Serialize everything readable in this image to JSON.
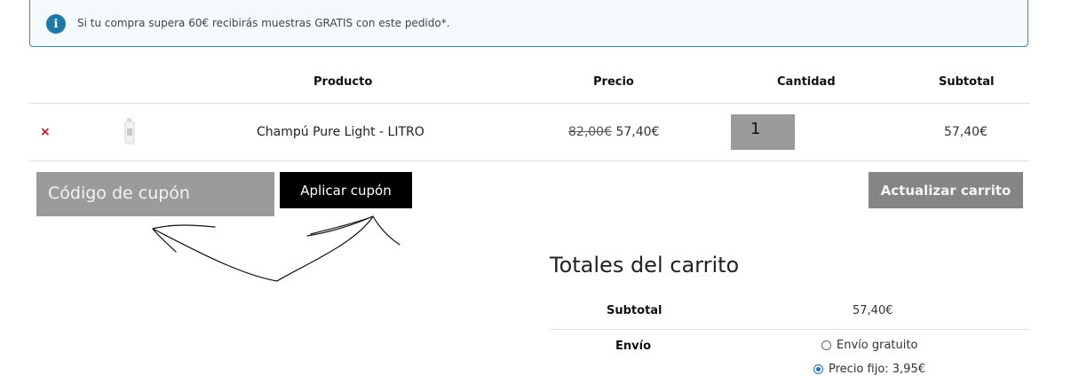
{
  "notice": {
    "icon": "info-icon",
    "text": "Si tu compra supera 60€ recibirás muestras GRATIS con este pedido*."
  },
  "table": {
    "headers": {
      "product": "Producto",
      "price": "Precio",
      "quantity": "Cantidad",
      "subtotal": "Subtotal"
    },
    "rows": [
      {
        "remove": "×",
        "name": "Champú Pure Light - LITRO",
        "old_price": "82,00€",
        "price": "57,40€",
        "quantity": "1",
        "subtotal": "57,40€"
      }
    ]
  },
  "coupon": {
    "placeholder": "Código de cupón",
    "apply_label": "Aplicar cupón"
  },
  "update_label": "Actualizar carrito",
  "totals": {
    "title": "Totales del carrito",
    "subtotal_label": "Subtotal",
    "subtotal_value": "57,40€",
    "shipping_label": "Envío",
    "shipping_options": [
      {
        "label": "Envío gratuito",
        "selected": false
      },
      {
        "label": "Precio fijo: 3,95€",
        "selected": true
      }
    ]
  },
  "colors": {
    "notice_border": "#3f8da5",
    "info_icon": "#1f79a8",
    "remove": "#c8102e",
    "apply_button": "#000000",
    "update_button": "#858585",
    "input_bg": "#9b9b9b"
  }
}
